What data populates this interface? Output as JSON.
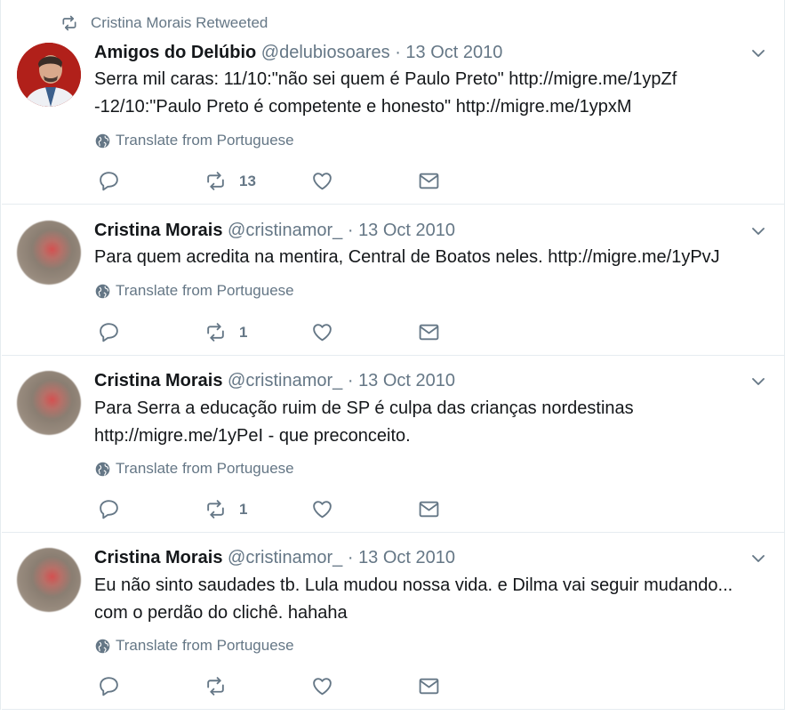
{
  "retweet_context": "Cristina Morais Retweeted",
  "translate_label": "Translate from Portuguese",
  "tweets": [
    {
      "name": "Amigos do Delúbio",
      "handle": "@delubiosoares",
      "separator": "·",
      "date": "13 Oct 2010",
      "lines": [
        "Serra mil caras: 11/10:\"não sei quem é Paulo Preto\" http://migre.me/1ypZf",
        "-12/10:\"Paulo Preto é competente e honesto\" http://migre.me/1ypxM"
      ],
      "retweets": "13"
    },
    {
      "name": "Cristina Morais",
      "handle": "@cristinamor_",
      "separator": "·",
      "date": "13 Oct 2010",
      "lines": [
        "Para quem acredita na mentira, Central de Boatos neles. http://migre.me/1yPvJ"
      ],
      "retweets": "1"
    },
    {
      "name": "Cristina Morais",
      "handle": "@cristinamor_",
      "separator": "·",
      "date": "13 Oct 2010",
      "lines": [
        "Para Serra a educação ruim de SP é culpa das crianças nordestinas",
        "http://migre.me/1yPeI - que preconceito."
      ],
      "retweets": "1"
    },
    {
      "name": "Cristina Morais",
      "handle": "@cristinamor_",
      "separator": "·",
      "date": "13 Oct 2010",
      "lines": [
        "Eu não sinto saudades tb. Lula mudou nossa vida. e Dilma vai seguir mudando...",
        "com o perdão do clichê. hahaha"
      ],
      "retweets": ""
    }
  ],
  "icons": {
    "reply": "reply-icon",
    "retweet": "retweet-icon",
    "like": "heart-icon",
    "dm": "envelope-icon",
    "globe": "globe-icon",
    "caret": "chevron-down-icon"
  },
  "colors": {
    "text": "#14171a",
    "muted": "#657786",
    "divider": "#e6ecf0"
  }
}
